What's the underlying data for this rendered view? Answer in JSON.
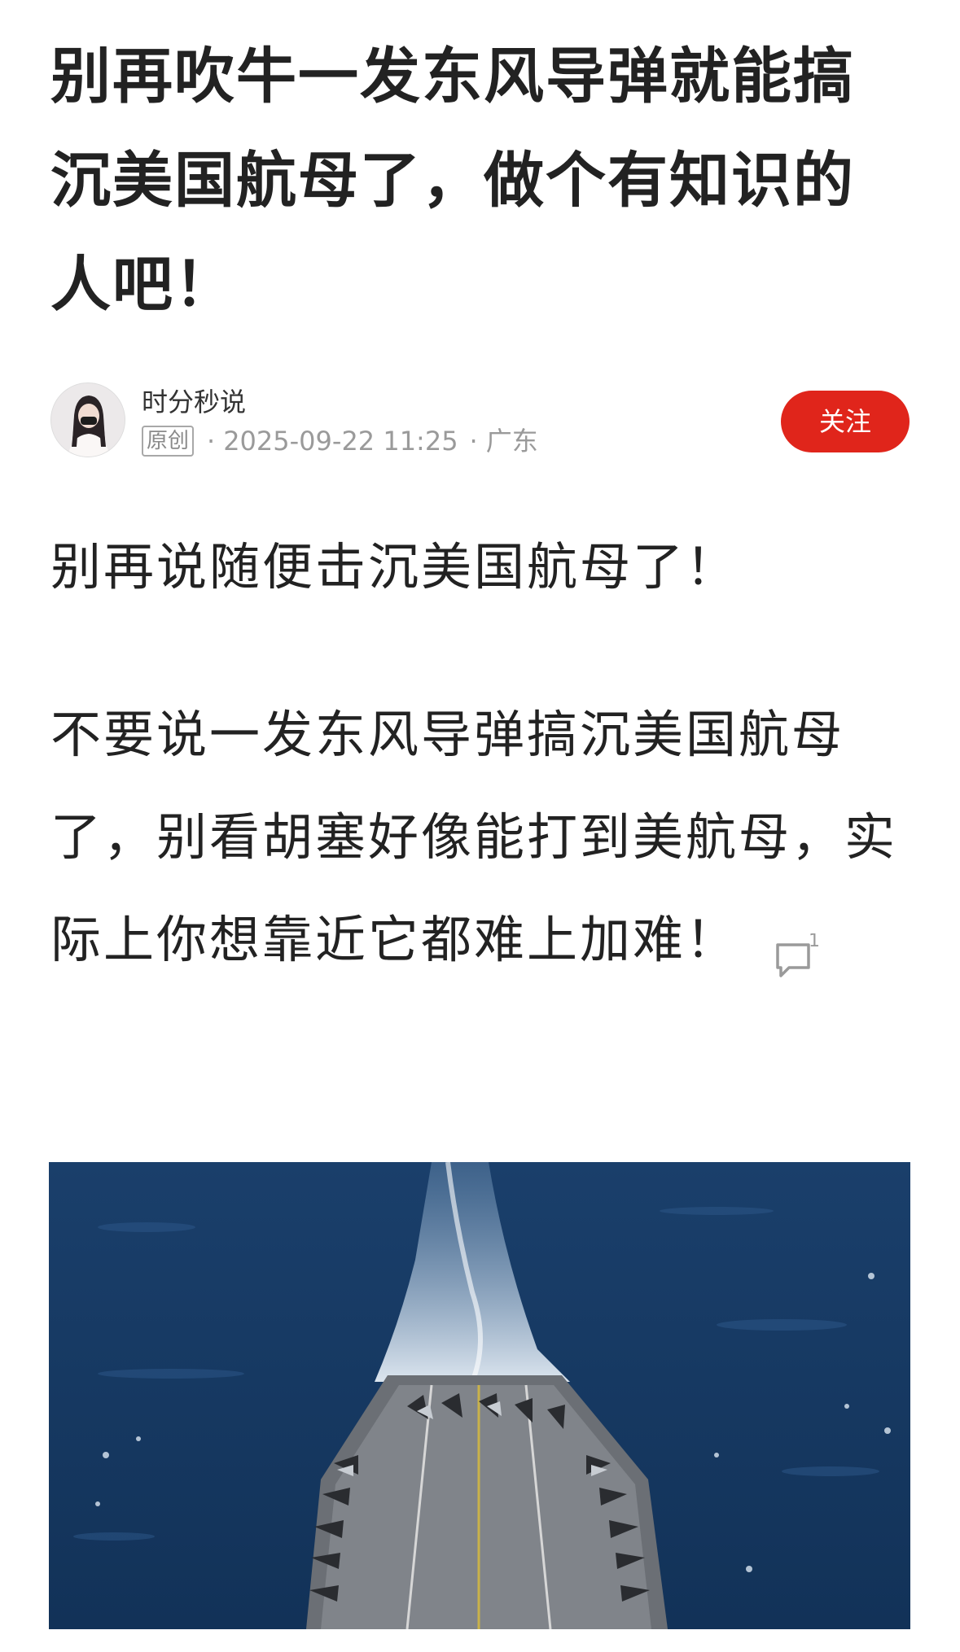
{
  "article": {
    "title": "别再吹牛一发东风导弹就能搞沉美国航母了，做个有知识的人吧！",
    "author": {
      "name": "时分秒说",
      "badge": "原创",
      "datetime": "2025-09-22 11:25",
      "location": "广东",
      "follow_label": "关注"
    },
    "paragraphs": [
      "别再说随便击沉美国航母了！",
      "不要说一发东风导弹搞沉美国航母了，别看胡塞好像能打到美航母，实际上你想靠近它都难上加难！"
    ],
    "comment_count": "1"
  },
  "icons": {
    "comment": "comment-bubble-icon",
    "avatar": "avatar-image"
  },
  "colors": {
    "follow": "#e0251b",
    "meta": "#9a9a9a",
    "text": "#222222"
  }
}
